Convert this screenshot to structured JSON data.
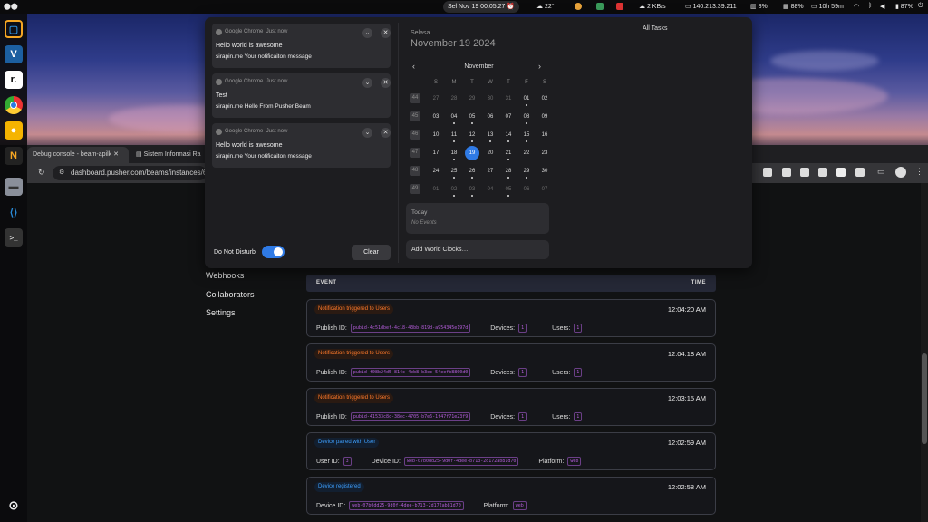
{
  "topbar": {
    "datetime": "Sel Nov 19  00:05:27",
    "weather": "22°",
    "net_speed": "2 KB/s",
    "ip": "140.213.39.211",
    "cpu": "8%",
    "memory": "88%",
    "uptime": "10h 59m",
    "battery": "87%"
  },
  "browser": {
    "tabs": [
      {
        "label": "Debug console - beam-apilk"
      },
      {
        "label": "Sistem Informasi Ra"
      }
    ],
    "url": "dashboard.pusher.com/beams/instances/6c"
  },
  "sidebar_nav": [
    "Webhooks",
    "Collaborators",
    "Settings"
  ],
  "event_table": {
    "col_event": "EVENT",
    "col_time": "TIME",
    "events": [
      {
        "badge": "Notification triggered to Users",
        "type": "orange",
        "time": "12:04:20 AM",
        "fields": [
          [
            "Publish ID:",
            "pubid-4c51dbef-4c18-43bb-819d-a954345e197d"
          ],
          [
            "Devices:",
            "1"
          ],
          [
            "Users:",
            "1"
          ]
        ]
      },
      {
        "badge": "Notification triggered to Users",
        "type": "orange",
        "time": "12:04:18 AM",
        "fields": [
          [
            "Publish ID:",
            "pubid-f08b24d5-814c-4eb8-b3ec-54eefb8800d0"
          ],
          [
            "Devices:",
            "1"
          ],
          [
            "Users:",
            "1"
          ]
        ]
      },
      {
        "badge": "Notification triggered to Users",
        "type": "orange",
        "time": "12:03:15 AM",
        "fields": [
          [
            "Publish ID:",
            "pubid-41533c8c-38ec-4705-b7e6-1f47f71e23f9"
          ],
          [
            "Devices:",
            "1"
          ],
          [
            "Users:",
            "1"
          ]
        ]
      },
      {
        "badge": "Device paired with User",
        "type": "blue",
        "time": "12:02:59 AM",
        "fields": [
          [
            "User ID:",
            "3"
          ],
          [
            "Device ID:",
            "web-07b0dd25-9d0f-4dee-b713-2d172ab81d70"
          ],
          [
            "Platform:",
            "web"
          ]
        ]
      },
      {
        "badge": "Device registered",
        "type": "blue",
        "time": "12:02:58 AM",
        "fields": [
          [
            "Device ID:",
            "web-07b0dd25-9d0f-4dee-b713-2d172ab81d70"
          ],
          [
            "Platform:",
            "web"
          ]
        ]
      }
    ]
  },
  "notifications": [
    {
      "app": "Google Chrome",
      "when": "Just now",
      "title": "Hello world is awesome",
      "body": "sirapin.me  Your notificaiton message ."
    },
    {
      "app": "Google Chrome",
      "when": "Just now",
      "title": "Test",
      "body": "sirapin.me  Hello From Pusher Beam"
    },
    {
      "app": "Google Chrome",
      "when": "Just now",
      "title": "Hello world is awesome",
      "body": "sirapin.me  Your notificaiton message ."
    }
  ],
  "dnd_label": "Do Not Disturb",
  "dnd_on": true,
  "clear_label": "Clear",
  "calendar": {
    "weekday": "Selasa",
    "date": "November 19 2024",
    "month": "November",
    "prev": "‹",
    "next": "›",
    "dow": [
      "S",
      "M",
      "T",
      "W",
      "T",
      "F",
      "S"
    ],
    "weeks": [
      {
        "wk": "44",
        "days": [
          "27",
          "28",
          "29",
          "30",
          "31",
          "01",
          "02"
        ]
      },
      {
        "wk": "45",
        "days": [
          "03",
          "04",
          "05",
          "06",
          "07",
          "08",
          "09"
        ]
      },
      {
        "wk": "46",
        "days": [
          "10",
          "11",
          "12",
          "13",
          "14",
          "15",
          "16"
        ]
      },
      {
        "wk": "47",
        "days": [
          "17",
          "18",
          "19",
          "20",
          "21",
          "22",
          "23"
        ]
      },
      {
        "wk": "48",
        "days": [
          "24",
          "25",
          "26",
          "27",
          "28",
          "29",
          "30"
        ]
      },
      {
        "wk": "49",
        "days": [
          "01",
          "02",
          "03",
          "04",
          "05",
          "06",
          "07"
        ]
      }
    ],
    "today_label": "Today",
    "no_events": "No Events",
    "world_clocks": "Add World Clocks…"
  },
  "tasks_title": "All Tasks",
  "colors": {
    "accent": "#2f7ae5",
    "orange": "#ff7a2a",
    "blue": "#3ea0ff",
    "code": "#b25cd8"
  }
}
